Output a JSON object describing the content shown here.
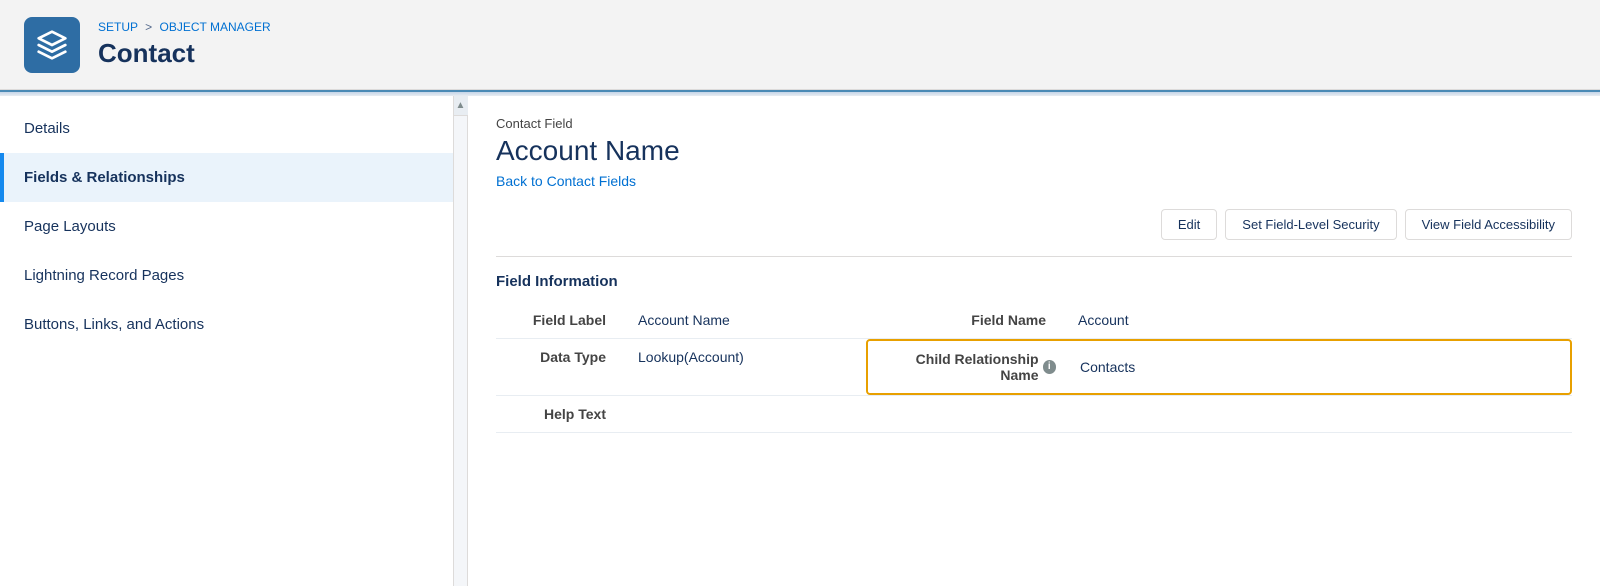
{
  "header": {
    "breadcrumb_part1": "SETUP",
    "breadcrumb_sep": ">",
    "breadcrumb_part2": "OBJECT MANAGER",
    "page_title": "Contact"
  },
  "sidebar": {
    "items": [
      {
        "id": "details",
        "label": "Details",
        "active": false
      },
      {
        "id": "fields-relationships",
        "label": "Fields & Relationships",
        "active": true
      },
      {
        "id": "page-layouts",
        "label": "Page Layouts",
        "active": false
      },
      {
        "id": "lightning-record-pages",
        "label": "Lightning Record Pages",
        "active": false
      },
      {
        "id": "buttons-links-actions",
        "label": "Buttons, Links, and Actions",
        "active": false
      }
    ]
  },
  "content": {
    "field_section_label": "Contact Field",
    "field_title": "Account Name",
    "back_link": "Back to Contact Fields",
    "buttons": {
      "edit": "Edit",
      "set_field_level_security": "Set Field-Level Security",
      "view_field_accessibility": "View Field Accessibility"
    },
    "section_title": "Field Information",
    "table": {
      "rows": [
        {
          "left_label": "Field Label",
          "left_value": "Account Name",
          "right_label": "Field Name",
          "right_value": "Account"
        },
        {
          "left_label": "Data Type",
          "left_value": "Lookup(Account)",
          "right_label": "Child Relationship Name",
          "right_value": "Contacts",
          "highlight": true
        },
        {
          "left_label": "Help Text",
          "left_value": "",
          "right_label": "",
          "right_value": ""
        }
      ]
    }
  },
  "icons": {
    "layers": "⊞",
    "back_arrow": "←",
    "info": "i"
  }
}
